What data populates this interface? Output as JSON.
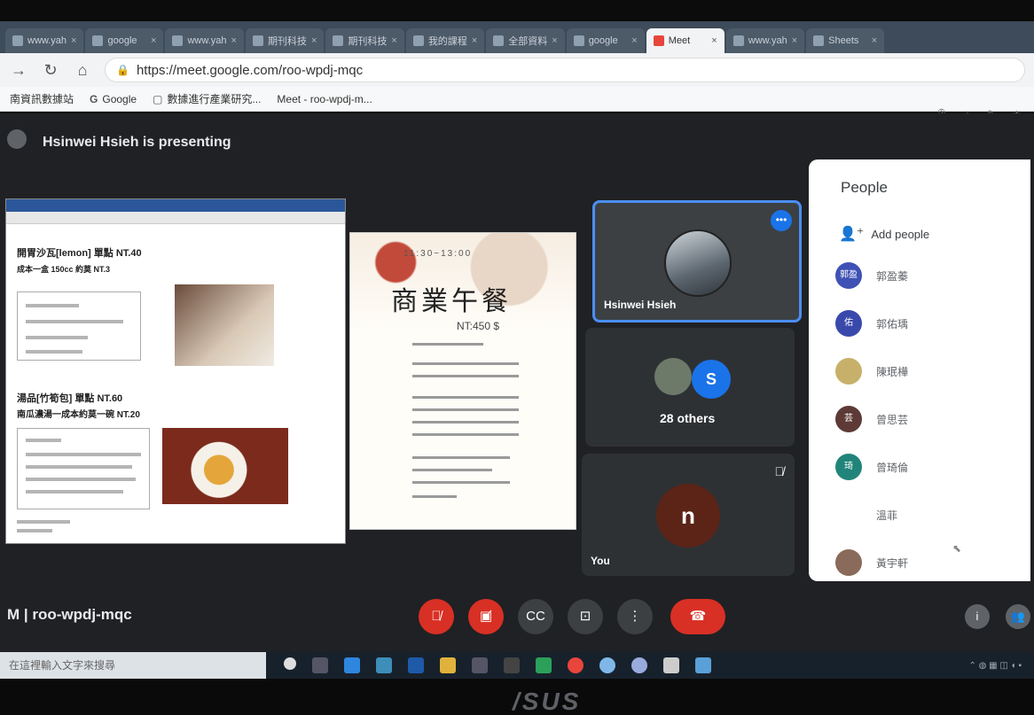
{
  "browser": {
    "tabs": [
      {
        "label": "www.yah"
      },
      {
        "label": "google"
      },
      {
        "label": "www.yah"
      },
      {
        "label": "期刊科技"
      },
      {
        "label": "期刊科技"
      },
      {
        "label": "我的課程"
      },
      {
        "label": "全部資料"
      },
      {
        "label": "google"
      },
      {
        "label": "Meet",
        "active": true
      },
      {
        "label": "www.yah"
      },
      {
        "label": "Sheets"
      }
    ],
    "url": "https://meet.google.com/roo-wpdj-mqc",
    "bookmarks": [
      {
        "icon": "",
        "label": "南資訊數據站"
      },
      {
        "icon": "G",
        "label": "Google"
      },
      {
        "icon": "▢",
        "label": "數據進行產業研究..."
      },
      {
        "icon": "■",
        "label": "Meet - roo-wpdj-m..."
      }
    ]
  },
  "meeting": {
    "presenting_text": "Hsinwei Hsieh is presenting",
    "code": "roo-wpdj-mqc",
    "code_prefix": "M  |"
  },
  "shared_doc": {
    "line1": "開胃沙瓦[lemon] 單點 NT.40",
    "line2": "成本一盒 150cc 約莫 NT.3",
    "line3": "湯品[竹筍包] 單點 NT.60",
    "line4": "南瓜濃湯一成本約莫一碗 NT.20"
  },
  "menu_poster": {
    "time": "11:30~13:00",
    "title": "商業午餐",
    "price": "NT:450 $"
  },
  "tiles": {
    "presenter_name": "Hsinwei Hsieh",
    "others_initial": "S",
    "others_label": "28 others",
    "self_initial": "n",
    "self_label": "You"
  },
  "people_panel": {
    "title": "People",
    "add_label": "Add people",
    "people": [
      {
        "initials": "郭盈",
        "name": "郭盈蓁",
        "color": "#3f51b5"
      },
      {
        "initials": "佑",
        "name": "郭佑瑀",
        "color": "#3949ab"
      },
      {
        "initials": "",
        "name": "陳珉樺",
        "color": "#c7b16a"
      },
      {
        "initials": "芸",
        "name": "曾思芸",
        "color": "#5d3a36"
      },
      {
        "initials": "琦",
        "name": "曾琦倫",
        "color": "#21847a"
      },
      {
        "initials": "",
        "name": "溫菲",
        "color": "#ffffff"
      },
      {
        "initials": "",
        "name": "黃宇軒",
        "color": "#8a6a5a"
      }
    ]
  },
  "taskbar": {
    "search_placeholder": "在這裡輸入文字來搜尋"
  },
  "brand": "/SUS",
  "colors": {
    "accent_blue": "#1a73e8",
    "mute_red": "#d93025",
    "meet_bg": "#202124"
  }
}
